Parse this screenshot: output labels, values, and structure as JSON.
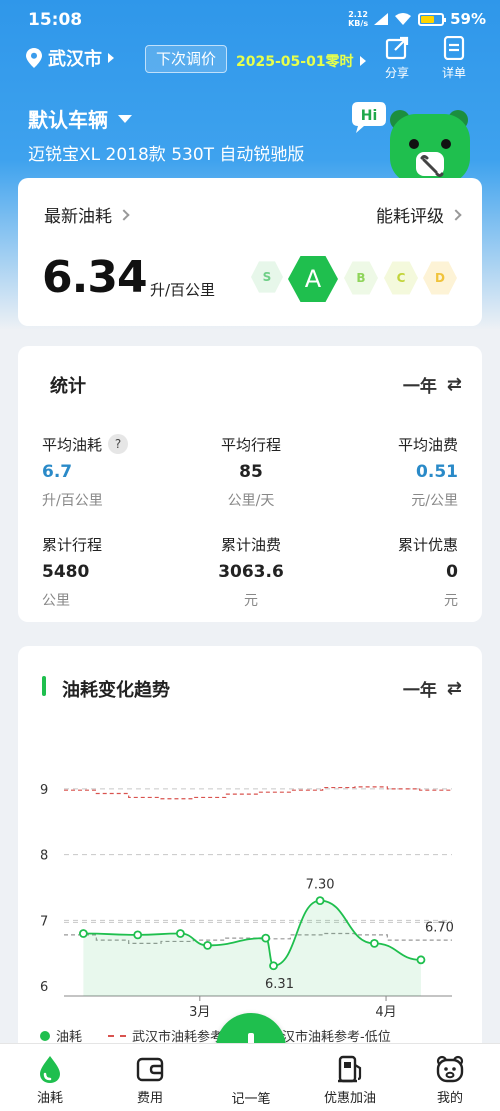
{
  "status_bar": {
    "time": "15:08",
    "net_speed_value": "2.12",
    "net_speed_unit": "KB/s",
    "battery": "59%"
  },
  "header": {
    "city": "武汉市",
    "price_adjust_label": "下次调价",
    "price_adjust_date": "2025-05-01零时",
    "share_label": "分享",
    "detail_label": "详单",
    "mascot_text": "Hi"
  },
  "vehicle": {
    "name": "默认车辆",
    "model": "迈锐宝XL 2018款 530T 自动锐驰版"
  },
  "latest": {
    "title": "最新油耗",
    "value": "6.34",
    "unit": "升/百公里",
    "rating_title": "能耗评级",
    "grades": [
      "S",
      "A",
      "B",
      "C",
      "D"
    ],
    "current_grade": "A"
  },
  "stats": {
    "title": "统计",
    "period": "一年",
    "items": [
      {
        "label": "平均油耗",
        "value": "6.7",
        "unit": "升/百公里"
      },
      {
        "label": "平均行程",
        "value": "85",
        "unit": "公里/天"
      },
      {
        "label": "平均油费",
        "value": "0.51",
        "unit": "元/公里"
      },
      {
        "label": "累计行程",
        "value": "5480",
        "unit": "公里"
      },
      {
        "label": "累计油费",
        "value": "3063.6",
        "unit": "元"
      },
      {
        "label": "累计优惠",
        "value": "0",
        "unit": "元"
      }
    ],
    "help_icon": "?"
  },
  "trend": {
    "title": "油耗变化趋势",
    "period": "一年",
    "legend": [
      {
        "label": "油耗",
        "color": "#1fbf4e"
      },
      {
        "label": "武汉市油耗参考",
        "color": "#d9534f"
      },
      {
        "label": "武汉市油耗参考-低位",
        "color": "#999999"
      }
    ]
  },
  "chart_data": {
    "type": "line",
    "title": "油耗变化趋势",
    "xlabel": "",
    "ylabel": "",
    "ylim": [
      5.85,
      9.5
    ],
    "y_ticks": [
      "6",
      "7",
      "8",
      "9"
    ],
    "x_ticks": [
      "3月",
      "4月"
    ],
    "series": [
      {
        "name": "油耗",
        "values": [
          6.8,
          6.78,
          6.8,
          6.62,
          6.73,
          6.31,
          7.3,
          6.65,
          6.4
        ],
        "x_positions": [
          0.05,
          0.19,
          0.3,
          0.37,
          0.52,
          0.54,
          0.66,
          0.8,
          0.92
        ],
        "labels_shown": [
          "7.30",
          "6.31",
          "6.70"
        ]
      },
      {
        "name": "武汉市油耗参考",
        "values": [
          8.98,
          8.93,
          8.87,
          8.85,
          8.87,
          8.92,
          8.95,
          8.98,
          9.02,
          9.03,
          9.0,
          8.98
        ],
        "style": "dashed"
      },
      {
        "name": "武汉市油耗参考-低位",
        "values": [
          6.78,
          6.7,
          6.65,
          6.68,
          6.7,
          6.73,
          6.72,
          6.78,
          6.8,
          6.78,
          6.7,
          6.7
        ],
        "style": "dashed"
      }
    ],
    "grid": true,
    "legend_position": "bottom"
  },
  "bottom_nav": {
    "items": [
      {
        "label": "油耗"
      },
      {
        "label": "费用"
      },
      {
        "label": "记一笔"
      },
      {
        "label": "优惠加油"
      },
      {
        "label": "我的"
      }
    ]
  },
  "colors": {
    "accent": "#1fbf4e",
    "header_blue": "#2f97ea",
    "stat_blue": "#2a8ac8",
    "date_yellow": "#e6ff4d"
  }
}
